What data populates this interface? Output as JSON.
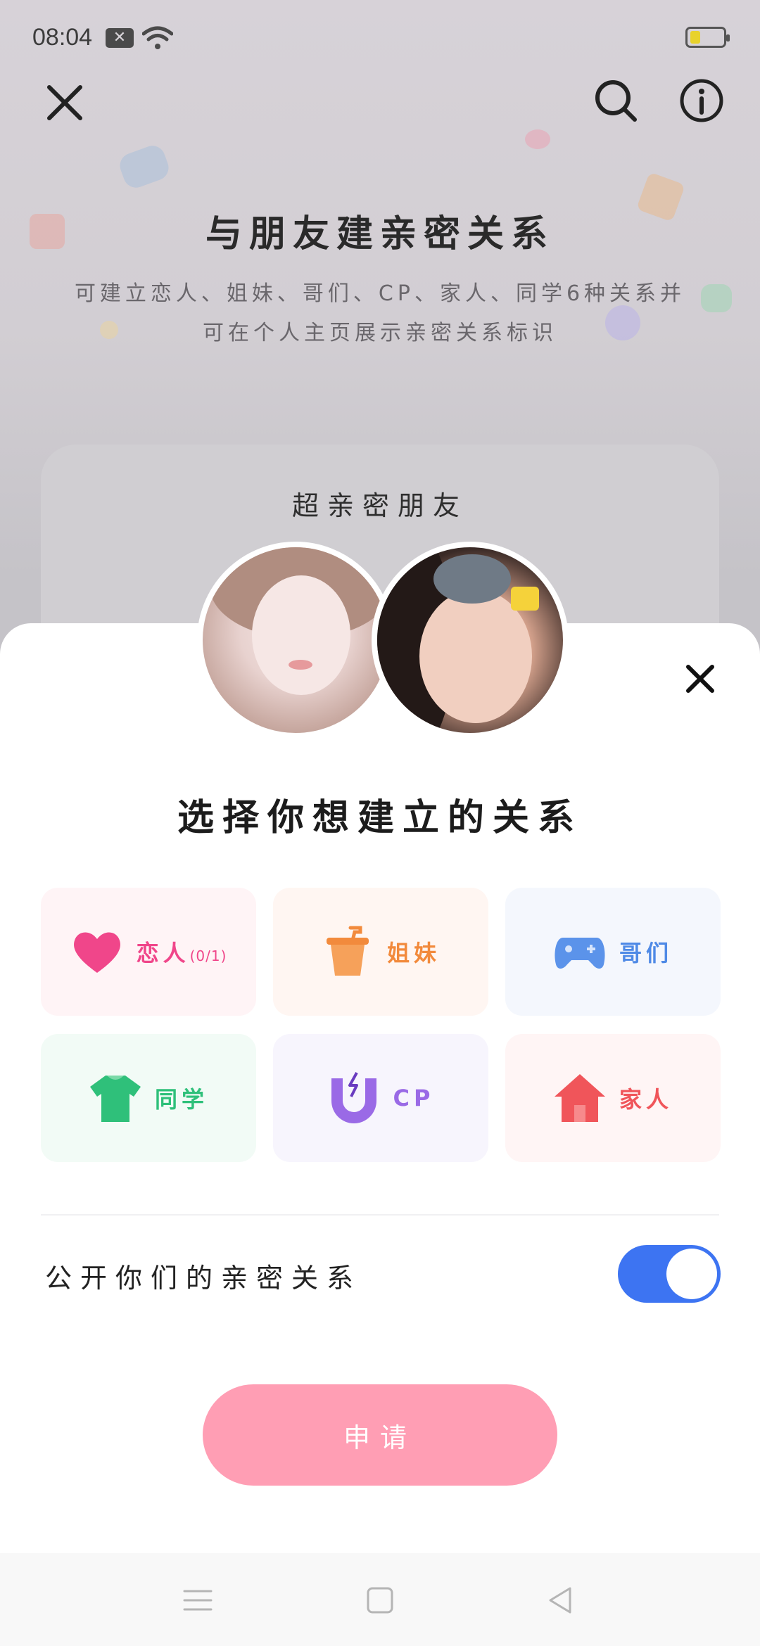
{
  "status_bar": {
    "time": "08:04",
    "notification_icon": "close-box-icon",
    "wifi_icon": "wifi-icon",
    "battery_icon": "battery-icon"
  },
  "header": {
    "close_icon": "close-icon",
    "search_icon": "search-icon",
    "info_icon": "info-icon"
  },
  "background_page": {
    "title": "与朋友建亲密关系",
    "description_line1": "可建立恋人、姐妹、哥们、CP、家人、同学6种关系并",
    "description_line2": "可在个人主页展示亲密关系标识",
    "card_title": "超亲密朋友"
  },
  "sheet": {
    "title": "选择你想建立的关系",
    "options": [
      {
        "label": "恋人",
        "sub": "(0/1)",
        "icon": "heart-icon",
        "color": "#f0468a",
        "bg": "#fff4f6"
      },
      {
        "label": "姐妹",
        "sub": "",
        "icon": "cup-icon",
        "color": "#f28a3c",
        "bg": "#fff6f2"
      },
      {
        "label": "哥们",
        "sub": "",
        "icon": "gamepad-icon",
        "color": "#4f8ae6",
        "bg": "#f4f7fd"
      },
      {
        "label": "同学",
        "sub": "",
        "icon": "tshirt-icon",
        "color": "#2fc07a",
        "bg": "#f2fbf6"
      },
      {
        "label": "CP",
        "sub": "",
        "icon": "magnet-icon",
        "color": "#9a6ae6",
        "bg": "#f7f5fd"
      },
      {
        "label": "家人",
        "sub": "",
        "icon": "house-icon",
        "color": "#f0555a",
        "bg": "#fff5f5"
      }
    ],
    "public_label": "公开你们的亲密关系",
    "public_toggle_on": true,
    "apply_label": "申请"
  },
  "nav": {
    "menu_icon": "menu-icon",
    "home_icon": "home-square-icon",
    "back_icon": "back-triangle-icon"
  },
  "colors": {
    "accent_blue": "#3d74f2",
    "apply_pink": "#ff9eb4"
  }
}
